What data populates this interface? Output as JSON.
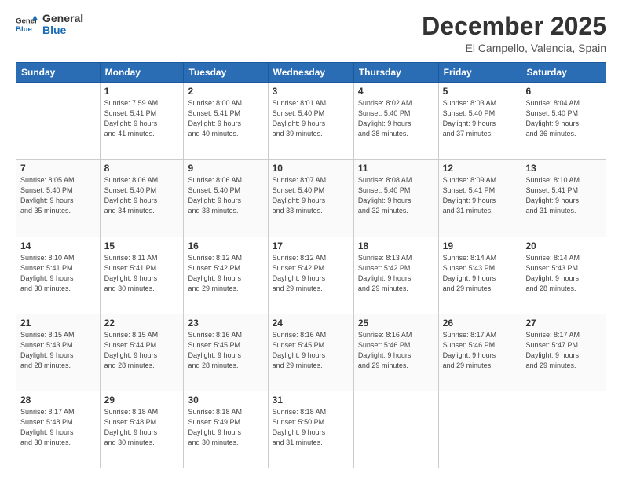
{
  "header": {
    "logo_general": "General",
    "logo_blue": "Blue",
    "month_title": "December 2025",
    "location": "El Campello, Valencia, Spain"
  },
  "weekdays": [
    "Sunday",
    "Monday",
    "Tuesday",
    "Wednesday",
    "Thursday",
    "Friday",
    "Saturday"
  ],
  "weeks": [
    [
      {
        "day": "",
        "sunrise": "",
        "sunset": "",
        "daylight": ""
      },
      {
        "day": "1",
        "sunrise": "Sunrise: 7:59 AM",
        "sunset": "Sunset: 5:41 PM",
        "daylight": "Daylight: 9 hours and 41 minutes."
      },
      {
        "day": "2",
        "sunrise": "Sunrise: 8:00 AM",
        "sunset": "Sunset: 5:41 PM",
        "daylight": "Daylight: 9 hours and 40 minutes."
      },
      {
        "day": "3",
        "sunrise": "Sunrise: 8:01 AM",
        "sunset": "Sunset: 5:40 PM",
        "daylight": "Daylight: 9 hours and 39 minutes."
      },
      {
        "day": "4",
        "sunrise": "Sunrise: 8:02 AM",
        "sunset": "Sunset: 5:40 PM",
        "daylight": "Daylight: 9 hours and 38 minutes."
      },
      {
        "day": "5",
        "sunrise": "Sunrise: 8:03 AM",
        "sunset": "Sunset: 5:40 PM",
        "daylight": "Daylight: 9 hours and 37 minutes."
      },
      {
        "day": "6",
        "sunrise": "Sunrise: 8:04 AM",
        "sunset": "Sunset: 5:40 PM",
        "daylight": "Daylight: 9 hours and 36 minutes."
      }
    ],
    [
      {
        "day": "7",
        "sunrise": "Sunrise: 8:05 AM",
        "sunset": "Sunset: 5:40 PM",
        "daylight": "Daylight: 9 hours and 35 minutes."
      },
      {
        "day": "8",
        "sunrise": "Sunrise: 8:06 AM",
        "sunset": "Sunset: 5:40 PM",
        "daylight": "Daylight: 9 hours and 34 minutes."
      },
      {
        "day": "9",
        "sunrise": "Sunrise: 8:06 AM",
        "sunset": "Sunset: 5:40 PM",
        "daylight": "Daylight: 9 hours and 33 minutes."
      },
      {
        "day": "10",
        "sunrise": "Sunrise: 8:07 AM",
        "sunset": "Sunset: 5:40 PM",
        "daylight": "Daylight: 9 hours and 33 minutes."
      },
      {
        "day": "11",
        "sunrise": "Sunrise: 8:08 AM",
        "sunset": "Sunset: 5:40 PM",
        "daylight": "Daylight: 9 hours and 32 minutes."
      },
      {
        "day": "12",
        "sunrise": "Sunrise: 8:09 AM",
        "sunset": "Sunset: 5:41 PM",
        "daylight": "Daylight: 9 hours and 31 minutes."
      },
      {
        "day": "13",
        "sunrise": "Sunrise: 8:10 AM",
        "sunset": "Sunset: 5:41 PM",
        "daylight": "Daylight: 9 hours and 31 minutes."
      }
    ],
    [
      {
        "day": "14",
        "sunrise": "Sunrise: 8:10 AM",
        "sunset": "Sunset: 5:41 PM",
        "daylight": "Daylight: 9 hours and 30 minutes."
      },
      {
        "day": "15",
        "sunrise": "Sunrise: 8:11 AM",
        "sunset": "Sunset: 5:41 PM",
        "daylight": "Daylight: 9 hours and 30 minutes."
      },
      {
        "day": "16",
        "sunrise": "Sunrise: 8:12 AM",
        "sunset": "Sunset: 5:42 PM",
        "daylight": "Daylight: 9 hours and 29 minutes."
      },
      {
        "day": "17",
        "sunrise": "Sunrise: 8:12 AM",
        "sunset": "Sunset: 5:42 PM",
        "daylight": "Daylight: 9 hours and 29 minutes."
      },
      {
        "day": "18",
        "sunrise": "Sunrise: 8:13 AM",
        "sunset": "Sunset: 5:42 PM",
        "daylight": "Daylight: 9 hours and 29 minutes."
      },
      {
        "day": "19",
        "sunrise": "Sunrise: 8:14 AM",
        "sunset": "Sunset: 5:43 PM",
        "daylight": "Daylight: 9 hours and 29 minutes."
      },
      {
        "day": "20",
        "sunrise": "Sunrise: 8:14 AM",
        "sunset": "Sunset: 5:43 PM",
        "daylight": "Daylight: 9 hours and 28 minutes."
      }
    ],
    [
      {
        "day": "21",
        "sunrise": "Sunrise: 8:15 AM",
        "sunset": "Sunset: 5:43 PM",
        "daylight": "Daylight: 9 hours and 28 minutes."
      },
      {
        "day": "22",
        "sunrise": "Sunrise: 8:15 AM",
        "sunset": "Sunset: 5:44 PM",
        "daylight": "Daylight: 9 hours and 28 minutes."
      },
      {
        "day": "23",
        "sunrise": "Sunrise: 8:16 AM",
        "sunset": "Sunset: 5:45 PM",
        "daylight": "Daylight: 9 hours and 28 minutes."
      },
      {
        "day": "24",
        "sunrise": "Sunrise: 8:16 AM",
        "sunset": "Sunset: 5:45 PM",
        "daylight": "Daylight: 9 hours and 29 minutes."
      },
      {
        "day": "25",
        "sunrise": "Sunrise: 8:16 AM",
        "sunset": "Sunset: 5:46 PM",
        "daylight": "Daylight: 9 hours and 29 minutes."
      },
      {
        "day": "26",
        "sunrise": "Sunrise: 8:17 AM",
        "sunset": "Sunset: 5:46 PM",
        "daylight": "Daylight: 9 hours and 29 minutes."
      },
      {
        "day": "27",
        "sunrise": "Sunrise: 8:17 AM",
        "sunset": "Sunset: 5:47 PM",
        "daylight": "Daylight: 9 hours and 29 minutes."
      }
    ],
    [
      {
        "day": "28",
        "sunrise": "Sunrise: 8:17 AM",
        "sunset": "Sunset: 5:48 PM",
        "daylight": "Daylight: 9 hours and 30 minutes."
      },
      {
        "day": "29",
        "sunrise": "Sunrise: 8:18 AM",
        "sunset": "Sunset: 5:48 PM",
        "daylight": "Daylight: 9 hours and 30 minutes."
      },
      {
        "day": "30",
        "sunrise": "Sunrise: 8:18 AM",
        "sunset": "Sunset: 5:49 PM",
        "daylight": "Daylight: 9 hours and 30 minutes."
      },
      {
        "day": "31",
        "sunrise": "Sunrise: 8:18 AM",
        "sunset": "Sunset: 5:50 PM",
        "daylight": "Daylight: 9 hours and 31 minutes."
      },
      {
        "day": "",
        "sunrise": "",
        "sunset": "",
        "daylight": ""
      },
      {
        "day": "",
        "sunrise": "",
        "sunset": "",
        "daylight": ""
      },
      {
        "day": "",
        "sunrise": "",
        "sunset": "",
        "daylight": ""
      }
    ]
  ]
}
